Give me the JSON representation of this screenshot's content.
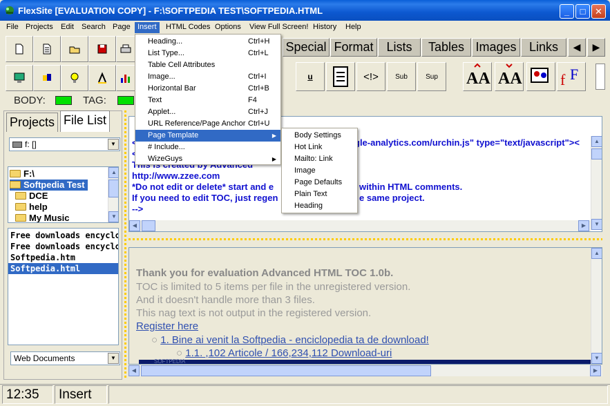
{
  "window": {
    "title": "FlexSite [EVALUATION COPY] - F:\\SOFTPEDIA TEST\\SOFTPEDIA.HTML",
    "minimize": "_",
    "maximize": "□",
    "close": "✕"
  },
  "menubar": [
    "File",
    "Projects",
    "Edit",
    "Search",
    "Page",
    "Insert",
    "HTML Codes",
    "Options",
    "View Full Screen!",
    "History",
    "Help"
  ],
  "tag_tabs": [
    "Special",
    "Format",
    "Lists",
    "Tables",
    "Images",
    "Links"
  ],
  "format_buttons": [
    "u",
    "<!>",
    "Sub",
    "Sup"
  ],
  "status_labels": {
    "body": "BODY:",
    "tag": "TAG:"
  },
  "left_panel": {
    "tabs": [
      "Projects",
      "File List"
    ],
    "drive": "f: []",
    "folders": [
      "F:\\",
      "Softpedia Test",
      "DCE",
      "help",
      "My Music"
    ],
    "files": [
      "Free downloads encyclo",
      "Free downloads encyclo",
      "Softpedia.htm",
      "Softpedia.html"
    ],
    "filter": "Web Documents"
  },
  "editor": {
    "lines": [
      "<",
      "gle-analytics.com/urchin.js\" type=\"text/javascript\"><",
      "<",
      "This is created by Advanced",
      "http://www.zzee.com",
      "*Do not edit or delete* start and e",
      "within HTML comments.",
      "If you need to edit TOC, just regen",
      "e same project.",
      "-->"
    ]
  },
  "preview": {
    "heading": "Thank you for evaluation Advanced HTML TOC 1.0b.",
    "lines": [
      "TOC is limited to 5 items per file in the unregistered version.",
      "And it doesn't handle more than 3 files.",
      "This nag text is not output in the registered version."
    ],
    "register": "Register here",
    "toc1": "1. Bine ai venit la Softpedia - enciclopedia ta de download!",
    "toc2": "1.1. ,102 Articole / 166,234,112 Download-uri",
    "banner": "SOFTPEDIA"
  },
  "insert_menu": [
    {
      "label": "Heading...",
      "key": "Ctrl+H"
    },
    {
      "label": "List Type...",
      "key": "Ctrl+L"
    },
    {
      "label": "Table Cell Attributes",
      "key": ""
    },
    {
      "label": "Image...",
      "key": "Ctrl+I"
    },
    {
      "label": "Horizontal Bar",
      "key": "Ctrl+B"
    },
    {
      "label": "Text",
      "key": "F4"
    },
    {
      "label": "Applet...",
      "key": "Ctrl+J"
    },
    {
      "label": "URL Reference/Page Anchor",
      "key": "Ctrl+U"
    },
    {
      "label": "Page Template",
      "key": ""
    },
    {
      "label": "# Include...",
      "key": ""
    },
    {
      "label": "WizeGuys",
      "key": ""
    }
  ],
  "page_template_submenu": [
    "Body Settings",
    "Hot Link",
    "Mailto: Link",
    "Image",
    "Page Defaults",
    "Plain Text",
    "Heading"
  ],
  "statusbar": {
    "time": "12:35",
    "mode": "Insert"
  },
  "colors": {
    "titlebar": "#0a5fd8",
    "selection": "#316ac5",
    "led": "#00e000",
    "code": "#1010d0"
  }
}
